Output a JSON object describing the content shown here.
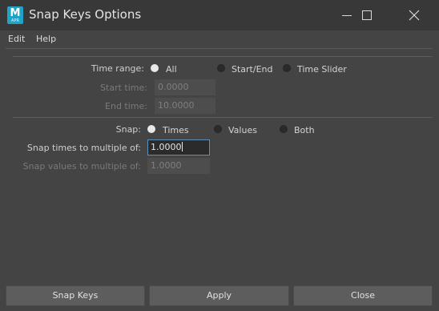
{
  "window": {
    "title": "Snap Keys Options",
    "icon_letter": "M",
    "icon_sub": "APR",
    "icons": [
      "minimize-icon",
      "maximize-icon",
      "close-icon"
    ]
  },
  "menu": [
    "Edit",
    "Help"
  ],
  "time_range": {
    "label": "Time range:",
    "options": [
      "All",
      "Start/End",
      "Time Slider"
    ],
    "selected": "All"
  },
  "start_time": {
    "label": "Start time:",
    "value": "0.0000"
  },
  "end_time": {
    "label": "End time:",
    "value": "10.0000"
  },
  "snap": {
    "label": "Snap:",
    "options": [
      "Times",
      "Values",
      "Both"
    ],
    "selected": "Times"
  },
  "snap_times": {
    "label": "Snap times to multiple of:",
    "value": "1.0000"
  },
  "snap_values": {
    "label": "Snap values to multiple of:",
    "value": "1.0000"
  },
  "buttons": {
    "snap_keys": "Snap Keys",
    "apply": "Apply",
    "close": "Close"
  },
  "colors": {
    "app_icon": "#1fa3c7",
    "focus_border": "#5e8fb8",
    "background": "#444444"
  }
}
